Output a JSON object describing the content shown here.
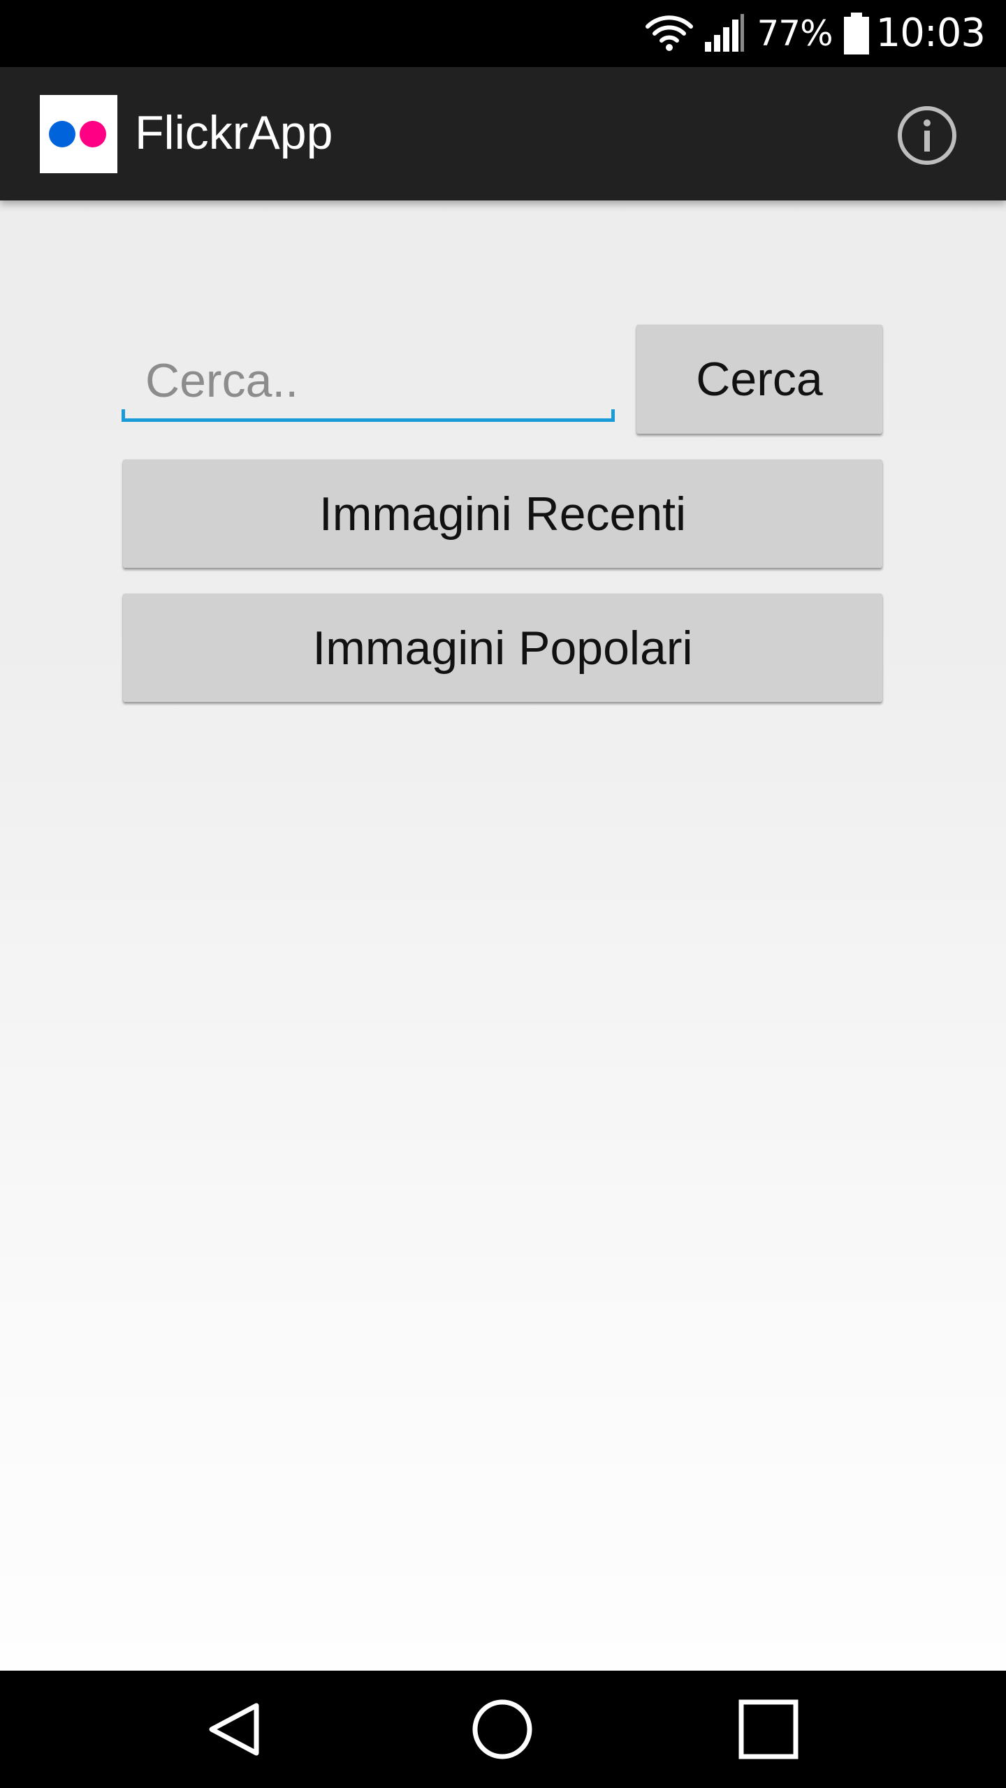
{
  "status_bar": {
    "battery_percent": "77%",
    "time": "10:03",
    "wifi_icon": "wifi-icon",
    "signal_icon": "cell-signal-icon",
    "battery_icon": "battery-icon"
  },
  "app_bar": {
    "title": "FlickrApp",
    "logo_icon": "flickr-logo-icon",
    "logo_colors": {
      "blue": "#0063dc",
      "pink": "#ff0084"
    },
    "info_icon": "info-icon"
  },
  "search": {
    "placeholder": "Cerca..",
    "value": "",
    "button_label": "Cerca",
    "underline_color": "#1a9bd7"
  },
  "buttons": {
    "recent_label": "Immagini Recenti",
    "popular_label": "Immagini Popolari"
  },
  "nav_bar": {
    "back_icon": "back-triangle-icon",
    "home_icon": "home-circle-icon",
    "recents_icon": "recents-square-icon"
  }
}
